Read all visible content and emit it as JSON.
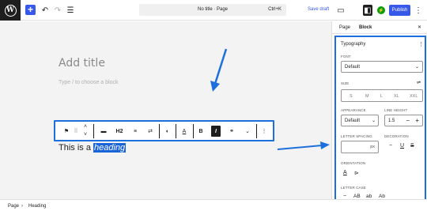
{
  "topbar": {
    "logo_letter": "W",
    "add_icon": "+",
    "undo_icon": "↶",
    "redo_icon": "↷",
    "list_view_icon": "☰",
    "command_title": "No title · Page",
    "command_shortcut": "Ctrl+K",
    "save_draft": "Save draft",
    "view_icon": "▭",
    "settings_icon": "◧",
    "jetpack_icon": "⚡",
    "publish": "Publish",
    "more_icon": "⋮"
  },
  "editor": {
    "title_placeholder": "Add title",
    "block_placeholder": "Type / to choose a block",
    "paragraph_prefix": "This is a ",
    "paragraph_highlight": "heading"
  },
  "block_toolbar": {
    "bookmark_icon": "⚑",
    "drag_icon": "⠿",
    "move_up_icon": "˄",
    "move_down_icon": "˅",
    "align_icon": "▬",
    "heading_level": "H2",
    "text_align_icon": "≡",
    "transform_icon": "⇄",
    "highlight_icon": "◖",
    "text_color_icon": "A",
    "bold": "B",
    "italic": "I",
    "link_icon": "⚭",
    "more_rich_icon": "⌄",
    "options_icon": "⋮"
  },
  "statusbar": {
    "crumb_page": "Page",
    "separator": "›",
    "crumb_heading": "Heading"
  },
  "sidebar": {
    "tab_page": "Page",
    "tab_block": "Block",
    "close_icon": "✕",
    "panel_title": "Typography",
    "panel_menu_icon": "⋮",
    "font_label": "FONT",
    "font_value": "Default",
    "size_label": "SIZE",
    "size_options": [
      "S",
      "M",
      "L",
      "XL",
      "XXL"
    ],
    "size_custom_icon": "⇌",
    "appearance_label": "APPEARANCE",
    "appearance_value": "Default",
    "line_height_label": "LINE HEIGHT",
    "line_height_value": "1.5",
    "line_height_minus": "−",
    "line_height_plus": "+",
    "letter_spacing_label": "LETTER SPACING",
    "letter_spacing_unit": "px",
    "decoration_label": "DECORATION",
    "decoration_none": "−",
    "decoration_underline": "U",
    "decoration_strike": "S",
    "orientation_label": "ORIENTATION",
    "orientation_horizontal": "A",
    "orientation_vertical": "⊳",
    "letter_case_label": "LETTER CASE",
    "letter_case_none": "−",
    "letter_case_upper": "AB",
    "letter_case_lower": "ab",
    "letter_case_capitalize": "Ab"
  },
  "colors": {
    "accent": "#3858e9",
    "annotation_blue": "#1d6fde",
    "highlight": "#1a63d8"
  }
}
